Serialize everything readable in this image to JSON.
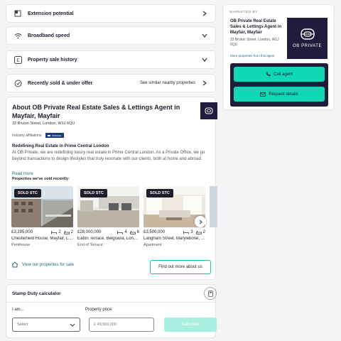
{
  "accordion": [
    {
      "label": "Extension potential",
      "icon": "extension-icon",
      "chevron": "right"
    },
    {
      "label": "Broadband speed",
      "icon": "wifi-icon",
      "chevron": "down"
    },
    {
      "label": "Property sale history",
      "icon": "pound-sign-icon",
      "chevron": "down"
    },
    {
      "label": "Recently sold & under offer",
      "icon": "sold-icon",
      "chevron": "right",
      "extra": "See similar nearby properties"
    }
  ],
  "about": {
    "title": "About OB Private Real Estate Sales & Lettings Agent in Mayfair, Mayfair",
    "address": "33 Bruton Street, London, W1J 6QU",
    "affiliations_label": "Industry affiliations",
    "subheading": "Redefining Real Estate in Prime Central London",
    "description": "At OB Private, we are redefining luxury real estate in Prime Central London. As a Private Office, we go beyond transactions to design lifestyles that truly resonate with our clients, both at home and abroad.",
    "read_more": "Read more",
    "sold_heading": "Properties we've sold recently:",
    "view_link": "View our properties for sale",
    "find_more": "Find out more about us"
  },
  "properties": [
    {
      "badge": "SOLD STC",
      "price": "£3,295,000",
      "beds": "2",
      "baths": "2",
      "address": "Chesterfield House, Mayfair, London",
      "type": "Penthouse"
    },
    {
      "badge": "SOLD STC",
      "price": "£28,000,000",
      "beds": "4",
      "baths": "6",
      "address": "Eaton Terrace, Belgravia, London",
      "type": "End of Terrace"
    },
    {
      "badge": "SOLD STC",
      "price": "£3,500,000",
      "beds": "3",
      "baths": "2",
      "address": "Langham Street, Marylebone, London",
      "type": "Apartment"
    }
  ],
  "stamp_duty": {
    "title": "Stamp Duty calculator",
    "i_am_label": "I am...",
    "price_label": "Property price",
    "select_placeholder": "Select",
    "price_placeholder": "£ 49,500,000",
    "calculate": "Calculate"
  },
  "agent": {
    "marketed_by": "MARKETED BY",
    "name": "OB Private Real Estate Sales & Lettings Agent in Mayfair, Mayfair",
    "address": "33 Bruton Street, London, W1J 6QU",
    "more_link": "More properties from this agent",
    "logo_text": "OB PRIVATE",
    "call": "Call agent",
    "request": "Request details"
  },
  "colors": {
    "accent": "#10d7b4",
    "brand_dark": "#1f1d3b",
    "link": "#1e6c7a"
  }
}
